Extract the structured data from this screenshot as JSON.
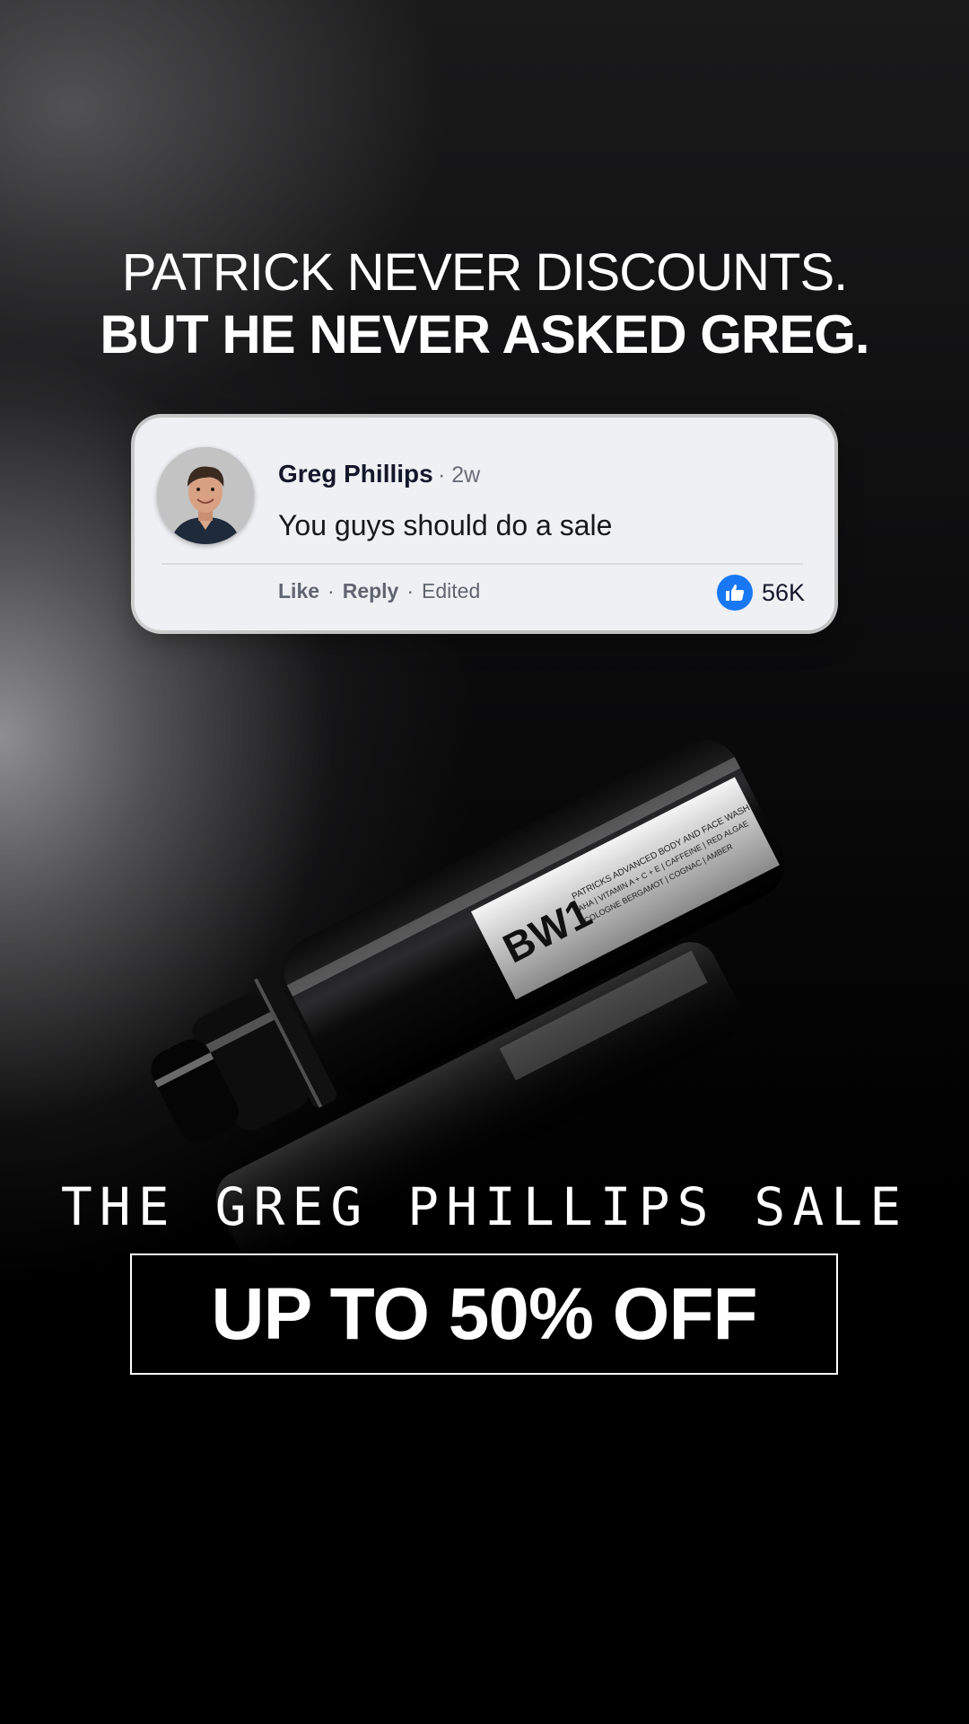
{
  "headline": {
    "line1": "PATRICK NEVER DISCOUNTS.",
    "line2": "BUT HE NEVER ASKED GREG."
  },
  "comment": {
    "author": "Greg Phillips",
    "time": "· 2w",
    "text": "You guys should do a sale",
    "actions": {
      "like": "Like",
      "reply": "Reply",
      "edited": "Edited",
      "separator": "·"
    },
    "reaction_icon": "thumbs-up-icon",
    "reaction_count": "56K"
  },
  "product": {
    "brand_mark": "BW1",
    "label_line1": "PATRICKS ADVANCED BODY AND FACE WASH",
    "label_line2": "AHA | VITAMIN A + C + E | CAFFEINE | RED ALGAE",
    "label_line3": "COLOGNE BERGAMOT | COGNAC | AMBER"
  },
  "sale": {
    "title": "THE GREG PHILLIPS SALE",
    "offer": "UP TO 50% OFF"
  },
  "colors": {
    "background": "#000000",
    "card": "#eef0f4",
    "like_blue": "#1877f2",
    "text_light": "#ffffff"
  }
}
